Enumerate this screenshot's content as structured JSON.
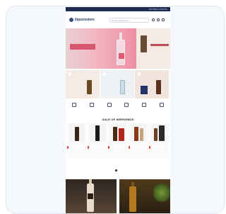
{
  "topbar": {
    "text": "ENTREGA GRATIS"
  },
  "header": {
    "logo_text": "liquorsstore",
    "search_placeholder": "Buscar productos..."
  },
  "hero": {
    "title": "",
    "subtitle": "",
    "side_title": ""
  },
  "promos": [
    {
      "tag": ""
    },
    {
      "tag": ""
    },
    {
      "tag": ""
    }
  ],
  "categories": [
    {
      "label": "",
      "icon": "category-icon"
    },
    {
      "label": "",
      "icon": "category-icon"
    },
    {
      "label": "",
      "icon": "category-icon"
    },
    {
      "label": "",
      "icon": "category-icon"
    },
    {
      "label": "",
      "icon": "category-icon"
    },
    {
      "label": "",
      "icon": "category-icon"
    }
  ],
  "section": {
    "title": "SALE OF WEEKENDS"
  },
  "products": [
    {
      "badge": "",
      "name": "",
      "price": ""
    },
    {
      "badge": "",
      "name": "",
      "price": ""
    },
    {
      "badge": "",
      "name": "",
      "price": ""
    },
    {
      "badge": "",
      "name": "",
      "price": ""
    },
    {
      "badge": "",
      "name": "",
      "price": ""
    }
  ],
  "colors": {
    "topbar": "#1f2b4d",
    "hero_pink": "#ef8fa2",
    "badge_red": "#e23a3a",
    "card_bg": "#f5f8fd"
  }
}
